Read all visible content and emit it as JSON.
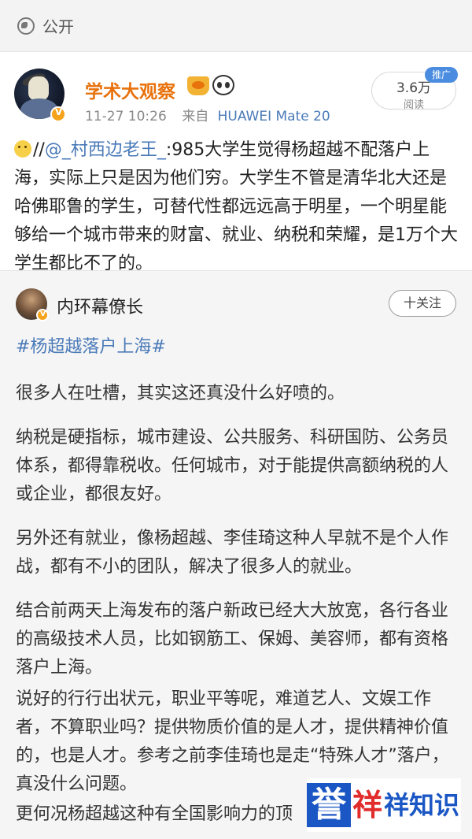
{
  "top_bar": {
    "visibility": "公开",
    "icon": "globe-icon"
  },
  "post": {
    "username": "学术大观察",
    "badges": [
      "crown-icon",
      "panda-icon"
    ],
    "timestamp": "11-27 10:26",
    "source_prefix": "来自",
    "device": "HUAWEI Mate 20",
    "reads_count": "3.6万",
    "reads_label": "阅读",
    "promo_label": "推广",
    "body_prefix": "//",
    "mention": "@_村西边老王_",
    "body": ":985大学生觉得杨超越不配落户上海，实际上只是因为他们穷。大学生不管是清华北大还是哈佛耶鲁的学生，可替代性都远远高于明星，一个明星能够给一个城市带来的财富、就业、纳税和荣耀，是1万个大学生都比不了的。"
  },
  "repost": {
    "author": "内环幕僚长",
    "follow_label": "十关注",
    "topic": "#杨超越落户上海#",
    "paragraphs": [
      "很多人在吐槽，其实这还真没什么好喷的。",
      "纳税是硬指标，城市建设、公共服务、科研国防、公务员体系，都得靠税收。任何城市，对于能提供高额纳税的人或企业，都很友好。",
      "另外还有就业，像杨超越、李佳琦这种人早就不是个人作战，都有不小的团队，解决了很多人的就业。",
      "结合前两天上海发布的落户新政已经大大放宽，各行各业的高级技术人员，比如钢筋工、保姆、美容师，都有资格落户上海。",
      "说好的行行出状元，职业平等呢，难道艺人、文娱工作者，不算职业吗？提供物质价值的是人才，提供精神价值的，也是人才。参考之前李佳琦也是走“特殊人才”落户，真没什么问题。",
      "更何况杨超越这种有全国影响力的顶"
    ]
  },
  "watermark": {
    "text": "誉祥祥知识"
  },
  "colors": {
    "username": "#e8720c",
    "link": "#4a7ab8",
    "promo": "#4a8de0"
  }
}
